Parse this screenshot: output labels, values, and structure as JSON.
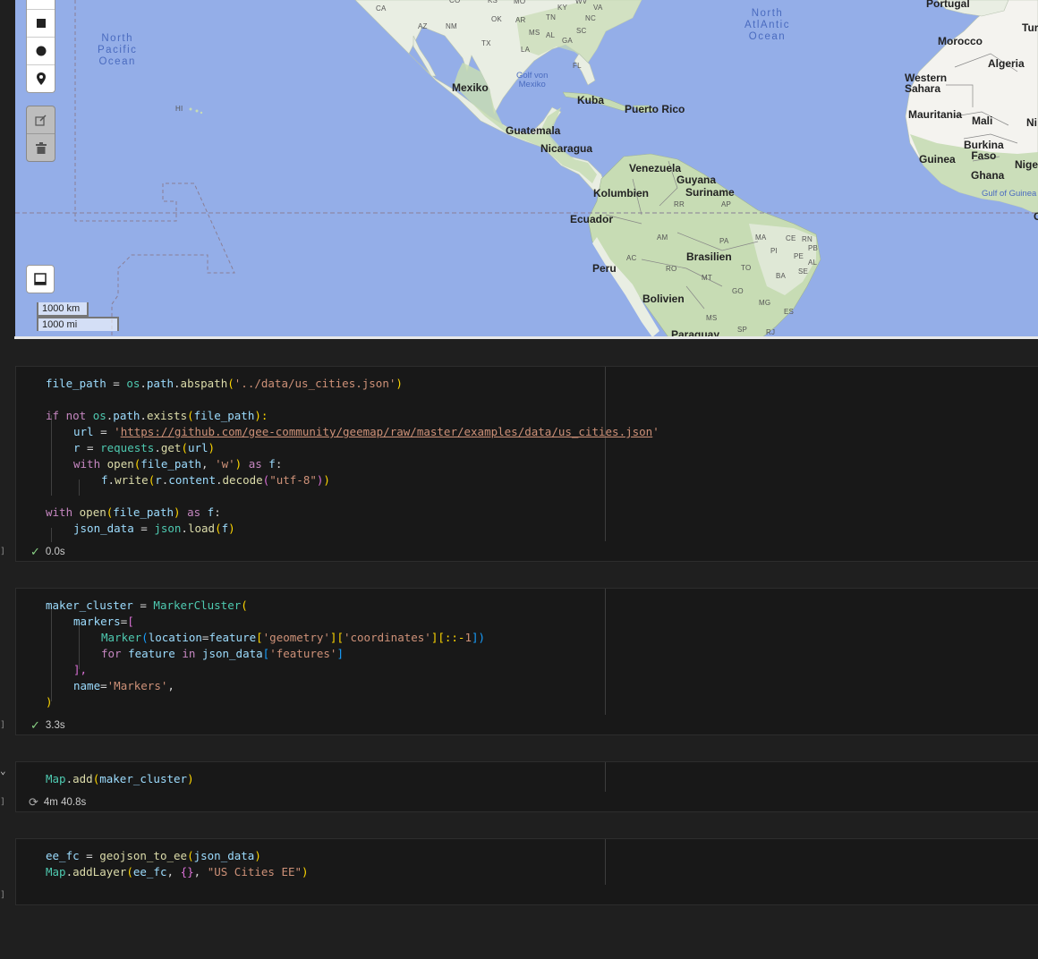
{
  "map": {
    "oceans": [
      {
        "name": "north-pacific",
        "text": "North\nPacific\nOcean"
      },
      {
        "name": "north-atlantic",
        "text": "North\nAtlAntic\nOcean"
      }
    ],
    "gulfs": [
      {
        "name": "gulf-mexico",
        "text": "Golf von\nMexiko"
      },
      {
        "name": "gulf-guinea",
        "text": "Gulf of Guinea"
      }
    ],
    "countries": [
      "Portugal",
      "Tur",
      "Morocco",
      "Algeria",
      "Western\nSahara",
      "Mauritania",
      "Mali",
      "Ni",
      "Burkina\nFaso",
      "Guinea",
      "Nige",
      "Ghana",
      "Mexiko",
      "Kuba",
      "Puerto Rico",
      "Guatemala",
      "Nicaragua",
      "Venezuela",
      "Guyana",
      "Suriname",
      "Kolumbien",
      "Ecuador",
      "Peru",
      "Brasilien",
      "Bolivien",
      "Paraguay",
      "C"
    ],
    "states": [
      "CA",
      "AZ",
      "NM",
      "OK",
      "AR",
      "TX",
      "LA",
      "MS",
      "AL",
      "GA",
      "SC",
      "NC",
      "TN",
      "KY",
      "MO",
      "KS",
      "CO",
      "VA",
      "WV",
      "FL",
      "HI",
      "RR",
      "AP",
      "AM",
      "PA",
      "MA",
      "CE",
      "RN",
      "PB",
      "PI",
      "PE",
      "AC",
      "RO",
      "MT",
      "TO",
      "AL",
      "SE",
      "BA",
      "GO",
      "MG",
      "ES",
      "MS",
      "SP",
      "RJ"
    ],
    "scale": {
      "km": "1000 km",
      "mi": "1000 mi"
    },
    "icons": [
      "marker-square-icon",
      "marker-circle-icon",
      "marker-pin-icon",
      "edit-icon",
      "trash-icon",
      "fullscreen-icon"
    ]
  },
  "cells": [
    {
      "name": "cell-load-json",
      "exec_count": "]",
      "status_icon": "check",
      "status_text": "0.0s"
    },
    {
      "name": "cell-marker-cluster",
      "exec_count": "]",
      "status_icon": "check",
      "status_text": "3.3s"
    },
    {
      "name": "cell-map-add",
      "exec_count": "]",
      "status_icon": "spinner",
      "status_text": "4m 40.8s"
    },
    {
      "name": "cell-geojson-ee",
      "exec_count": "]",
      "status_icon": "",
      "status_text": ""
    }
  ],
  "code": {
    "c1": {
      "l1_a": "file_path",
      "l1_b": " = ",
      "l1_c": "os",
      "l1_d": ".",
      "l1_e": "path",
      "l1_f": ".",
      "l1_g": "abspath",
      "l1_h": "(",
      "l1_i": "'../data/us_cities.json'",
      "l1_j": ")",
      "l2_a": "if",
      "l2_b": " ",
      "l2_c": "not",
      "l2_d": " ",
      "l2_e": "os",
      "l2_f": ".",
      "l2_g": "path",
      "l2_h": ".",
      "l2_i": "exists",
      "l2_j": "(",
      "l2_k": "file_path",
      "l2_l": "):",
      "l3_a": "url",
      "l3_b": " = ",
      "l3_c": "'",
      "l3_d": "https://github.com/gee-community/geemap/raw/master/examples/data/us_cities.json",
      "l3_e": "'",
      "l4_a": "r",
      "l4_b": " = ",
      "l4_c": "requests",
      "l4_d": ".",
      "l4_e": "get",
      "l4_f": "(",
      "l4_g": "url",
      "l4_h": ")",
      "l5_a": "with",
      "l5_b": " ",
      "l5_c": "open",
      "l5_d": "(",
      "l5_e": "file_path",
      "l5_f": ", ",
      "l5_g": "'w'",
      "l5_h": ")",
      "l5_i": " as ",
      "l5_j": "f",
      "l5_k": ":",
      "l6_a": "f",
      "l6_b": ".",
      "l6_c": "write",
      "l6_d": "(",
      "l6_e": "r",
      "l6_f": ".",
      "l6_g": "content",
      "l6_h": ".",
      "l6_i": "decode",
      "l6_j": "(",
      "l6_k": "\"utf-8\"",
      "l6_l": ")",
      "l6_m": ")",
      "l7_a": "with",
      "l7_b": " ",
      "l7_c": "open",
      "l7_d": "(",
      "l7_e": "file_path",
      "l7_f": ")",
      "l7_g": " as ",
      "l7_h": "f",
      "l7_i": ":",
      "l8_a": "json_data",
      "l8_b": " = ",
      "l8_c": "json",
      "l8_d": ".",
      "l8_e": "load",
      "l8_f": "(",
      "l8_g": "f",
      "l8_h": ")"
    },
    "c2": {
      "l1_a": "maker_cluster",
      "l1_b": " = ",
      "l1_c": "MarkerCluster",
      "l1_d": "(",
      "l2_a": "markers",
      "l2_b": "=",
      "l2_c": "[",
      "l3_a": "Marker",
      "l3_b": "(",
      "l3_c": "location",
      "l3_d": "=",
      "l3_e": "feature",
      "l3_f": "[",
      "l3_g": "'geometry'",
      "l3_h": "][",
      "l3_i": "'coordinates'",
      "l3_j": "][::-",
      "l3_k": "1",
      "l3_l": "])",
      "l4_a": "for",
      "l4_b": " ",
      "l4_c": "feature",
      "l4_d": " ",
      "l4_e": "in",
      "l4_f": " ",
      "l4_g": "json_data",
      "l4_h": "[",
      "l4_i": "'features'",
      "l4_j": "]",
      "l5_a": "],",
      "l6_a": "name",
      "l6_b": "=",
      "l6_c": "'Markers'",
      "l6_d": ",",
      "l7_a": ")"
    },
    "c3": {
      "l1_a": "Map",
      "l1_b": ".",
      "l1_c": "add",
      "l1_d": "(",
      "l1_e": "maker_cluster",
      "l1_f": ")"
    },
    "c4": {
      "l1_a": "ee_fc",
      "l1_b": " = ",
      "l1_c": "geojson_to_ee",
      "l1_d": "(",
      "l1_e": "json_data",
      "l1_f": ")",
      "l2_a": "Map",
      "l2_b": ".",
      "l2_c": "addLayer",
      "l2_d": "(",
      "l2_e": "ee_fc",
      "l2_f": ", ",
      "l2_g": "{}",
      "l2_h": ", ",
      "l2_i": "\"US Cities EE\"",
      "l2_j": ")"
    }
  },
  "colors": {
    "ocean": "#94aee8",
    "land": "#e9eee3",
    "vegetation": "#c7dcb4",
    "editor_bg": "#181818",
    "page_bg": "#1f1f1f",
    "check": "#89d185"
  }
}
